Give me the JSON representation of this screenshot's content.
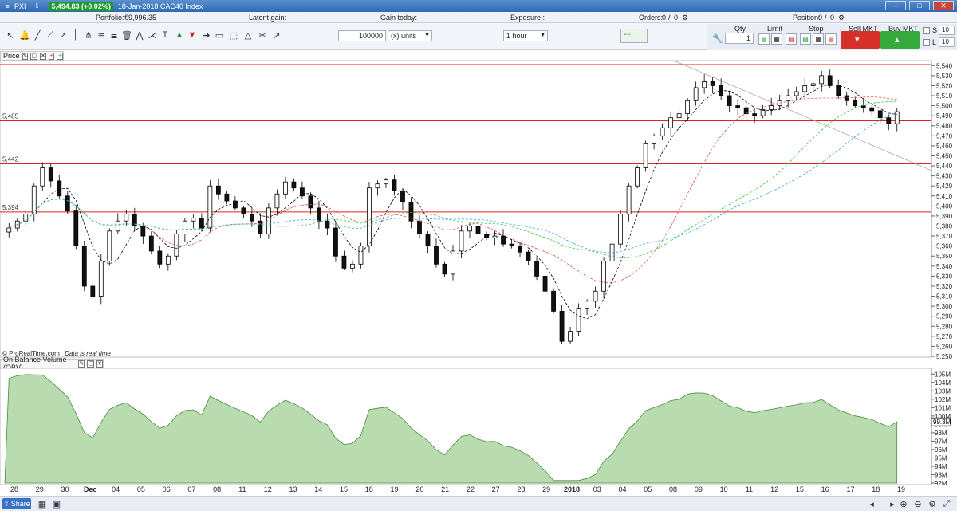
{
  "titlebar": {
    "app_label": "PXI",
    "price_badge": "5,494.83 (+0.02%)",
    "title": "18-Jan-2018 CAC40 Index",
    "colors": {
      "badge": "#1e9a2e",
      "bar": "#3a78c4"
    }
  },
  "infobar": {
    "portfolio_label": "Portfolio:",
    "portfolio_value": "€9,996.35",
    "latent_label": "Latent gain:",
    "latent_value": "-",
    "gain_today_label": "Gain today:",
    "gain_today_value": "-",
    "exposure_label": "Exposure :",
    "exposure_value": "-",
    "orders_label": "Orders:",
    "orders_value": "0",
    "orders_value2": "0",
    "position_label": "Position:",
    "position_value": "0",
    "position_value2": "0"
  },
  "toolbar": {
    "quantity_value": "100000",
    "units_select": "(x) units",
    "timeframe_select": "1 hour"
  },
  "trade_panel": {
    "qty_label": "Qty",
    "qty_value": "1",
    "limit_label": "Limit",
    "stop_label": "Stop",
    "sell_label": "Sell MKT",
    "buy_label": "Buy MKT",
    "s_label": "S",
    "s_value": "10",
    "l_label": "L",
    "l_value": "10"
  },
  "price_panel": {
    "header": "Price",
    "footer": "© ProRealTime.com",
    "footer_note": "Data is real time",
    "hlines": [
      {
        "label": "",
        "value": 5541
      },
      {
        "label": "5,485",
        "value": 5485
      },
      {
        "label": "5,442",
        "value": 5442
      },
      {
        "label": "5,394",
        "value": 5394
      }
    ],
    "yticks": [
      "5,540",
      "5,530",
      "5,520",
      "5,510",
      "5,500",
      "5,490",
      "5,480",
      "5,470",
      "5,460",
      "5,450",
      "5,440",
      "5,430",
      "5,420",
      "5,410",
      "5,400",
      "5,390",
      "5,380",
      "5,370",
      "5,360",
      "5,350",
      "5,340",
      "5,330",
      "5,320",
      "5,310",
      "5,300",
      "5,290",
      "5,280",
      "5,270",
      "5,260",
      "5,250"
    ]
  },
  "obv_panel": {
    "header": "On Balance Volume (OBV)",
    "current_value": "99.3M",
    "yticks": [
      "105M",
      "104M",
      "103M",
      "102M",
      "101M",
      "100M",
      "99M",
      "98M",
      "97M",
      "96M",
      "95M",
      "94M",
      "93M",
      "92M"
    ]
  },
  "x_axis": {
    "labels": [
      "28",
      "29",
      "30",
      "Dec",
      "04",
      "05",
      "06",
      "07",
      "08",
      "11",
      "12",
      "13",
      "14",
      "15",
      "18",
      "19",
      "20",
      "21",
      "22",
      "27",
      "28",
      "29",
      "2018",
      "03",
      "04",
      "05",
      "08",
      "09",
      "10",
      "11",
      "12",
      "15",
      "16",
      "17",
      "18",
      "19"
    ]
  },
  "statusbar": {
    "share_label": "Share"
  },
  "chart_data": {
    "type": "candlestick",
    "title": "18-Jan-2018 CAC40 Index",
    "ylim": [
      5250,
      5545
    ],
    "close_series": [
      5378,
      5385,
      5392,
      5420,
      5438,
      5425,
      5410,
      5395,
      5360,
      5320,
      5310,
      5345,
      5375,
      5385,
      5392,
      5380,
      5370,
      5355,
      5342,
      5350,
      5372,
      5385,
      5388,
      5378,
      5420,
      5412,
      5405,
      5398,
      5392,
      5385,
      5372,
      5398,
      5412,
      5424,
      5418,
      5410,
      5398,
      5385,
      5378,
      5350,
      5338,
      5342,
      5360,
      5418,
      5422,
      5426,
      5415,
      5404,
      5385,
      5372,
      5360,
      5342,
      5332,
      5355,
      5375,
      5380,
      5372,
      5368,
      5370,
      5362,
      5360,
      5354,
      5345,
      5330,
      5315,
      5295,
      5265,
      5275,
      5298,
      5305,
      5315,
      5345,
      5362,
      5392,
      5420,
      5438,
      5462,
      5470,
      5478,
      5488,
      5492,
      5505,
      5518,
      5524,
      5520,
      5510,
      5500,
      5498,
      5492,
      5490,
      5496,
      5500,
      5505,
      5510,
      5514,
      5520,
      5522,
      5530,
      5520,
      5510,
      5505,
      5500,
      5498,
      5495,
      5488,
      5482,
      5494
    ]
  }
}
